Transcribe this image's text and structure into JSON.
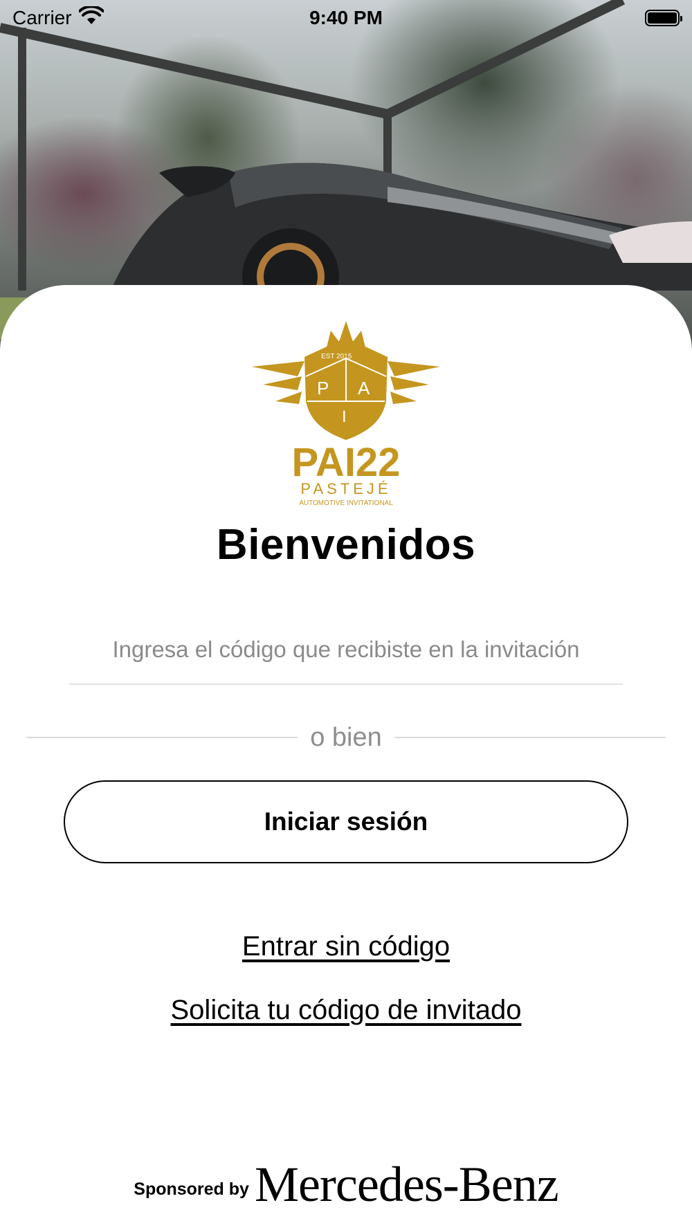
{
  "status_bar": {
    "carrier": "Carrier",
    "time": "9:40 PM"
  },
  "icons": {
    "wifi": "wifi-icon",
    "battery": "battery-icon",
    "logo": "pai-crest-logo"
  },
  "colors": {
    "brand_gold": "#C4961F",
    "text_primary": "#000000",
    "text_muted": "#8a8a8a",
    "divider": "#d9d9d9"
  },
  "logo": {
    "crest_letters": [
      "P",
      "A",
      "I"
    ],
    "est_text": "EST 2015",
    "wordmark": "PAI22",
    "subtitle": "PASTEJÉ",
    "tagline": "AUTOMOTIVE INVITATIONAL"
  },
  "main": {
    "title": "Bienvenidos",
    "code_placeholder": "Ingresa el código que recibiste en la invitación",
    "code_value": "",
    "divider_text": "o bien",
    "login_label": "Iniciar sesión",
    "no_code_link": "Entrar sin código",
    "request_code_link": "Solicita tu código de invitado"
  },
  "footer": {
    "sponsored_label": "Sponsored by",
    "sponsor_name": "Mercedes-Benz"
  }
}
